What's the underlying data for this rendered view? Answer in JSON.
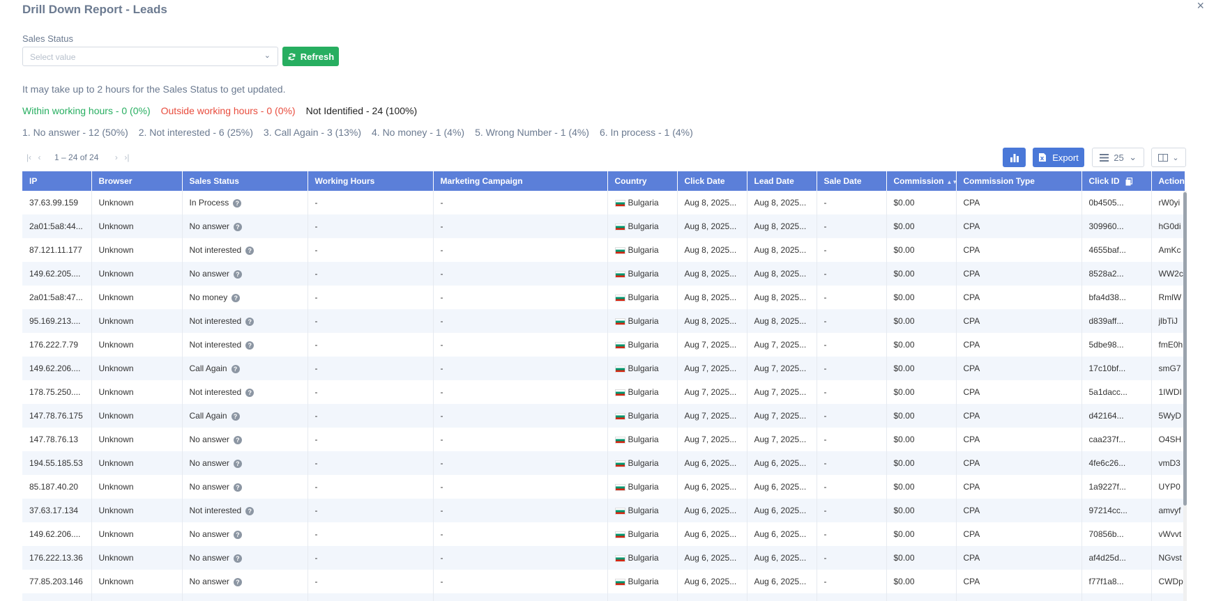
{
  "header": {
    "title": "Drill Down Report - Leads",
    "close_glyph": "×"
  },
  "filter": {
    "label": "Sales Status",
    "placeholder": "Select value",
    "refresh_label": "Refresh"
  },
  "note": "It may take up to 2 hours for the Sales Status to get updated.",
  "hours_summary": {
    "within": "Within working hours - 0 (0%)",
    "outside": "Outside working hours - 0 (0%)",
    "not_identified": "Not Identified - 24 (100%)"
  },
  "reasons": [
    "1. No answer - 12 (50%)",
    "2. Not interested - 6 (25%)",
    "3. Call Again - 3 (13%)",
    "4. No money - 1 (4%)",
    "5. Wrong Number - 1 (4%)",
    "6. In process - 1 (4%)"
  ],
  "pager": {
    "range": "1 – 24 of 24"
  },
  "toolbar": {
    "export_label": "Export",
    "page_size": "25"
  },
  "colors": {
    "header_bg": "#5b7fd9",
    "button_blue": "#4a78d8",
    "refresh_green": "#27ae60",
    "within_green": "#27ae60",
    "outside_red": "#e84c3d"
  },
  "table": {
    "headers": [
      "IP",
      "Browser",
      "Sales Status",
      "Working Hours",
      "Marketing Campaign",
      "Country",
      "Click Date",
      "Lead Date",
      "Sale Date",
      "Commission",
      "Commission Type",
      "Click ID",
      "Action I"
    ],
    "rows": [
      [
        "37.63.99.159",
        "Unknown",
        "In Process",
        "-",
        "-",
        "Bulgaria",
        "Aug 8, 2025...",
        "Aug 8, 2025...",
        "-",
        "$0.00",
        "CPA",
        "0b4505...",
        "rW0yi"
      ],
      [
        "2a01:5a8:44...",
        "Unknown",
        "No answer",
        "-",
        "-",
        "Bulgaria",
        "Aug 8, 2025...",
        "Aug 8, 2025...",
        "-",
        "$0.00",
        "CPA",
        "309960...",
        "hG0di"
      ],
      [
        "87.121.11.177",
        "Unknown",
        "Not interested",
        "-",
        "-",
        "Bulgaria",
        "Aug 8, 2025...",
        "Aug 8, 2025...",
        "-",
        "$0.00",
        "CPA",
        "4655baf...",
        "AmKc"
      ],
      [
        "149.62.205....",
        "Unknown",
        "No answer",
        "-",
        "-",
        "Bulgaria",
        "Aug 8, 2025...",
        "Aug 8, 2025...",
        "-",
        "$0.00",
        "CPA",
        "8528a2...",
        "WW2c"
      ],
      [
        "2a01:5a8:47...",
        "Unknown",
        "No money",
        "-",
        "-",
        "Bulgaria",
        "Aug 8, 2025...",
        "Aug 8, 2025...",
        "-",
        "$0.00",
        "CPA",
        "bfa4d38...",
        "RmlW"
      ],
      [
        "95.169.213....",
        "Unknown",
        "Not interested",
        "-",
        "-",
        "Bulgaria",
        "Aug 8, 2025...",
        "Aug 8, 2025...",
        "-",
        "$0.00",
        "CPA",
        "d839aff...",
        "jlbTiJ"
      ],
      [
        "176.222.7.79",
        "Unknown",
        "Not interested",
        "-",
        "-",
        "Bulgaria",
        "Aug 7, 2025...",
        "Aug 7, 2025...",
        "-",
        "$0.00",
        "CPA",
        "5dbe98...",
        "fmE0h"
      ],
      [
        "149.62.206....",
        "Unknown",
        "Call Again",
        "-",
        "-",
        "Bulgaria",
        "Aug 7, 2025...",
        "Aug 7, 2025...",
        "-",
        "$0.00",
        "CPA",
        "17c10bf...",
        "smG7"
      ],
      [
        "178.75.250....",
        "Unknown",
        "Not interested",
        "-",
        "-",
        "Bulgaria",
        "Aug 7, 2025...",
        "Aug 7, 2025...",
        "-",
        "$0.00",
        "CPA",
        "5a1dacc...",
        "1IWDI"
      ],
      [
        "147.78.76.175",
        "Unknown",
        "Call Again",
        "-",
        "-",
        "Bulgaria",
        "Aug 7, 2025...",
        "Aug 7, 2025...",
        "-",
        "$0.00",
        "CPA",
        "d42164...",
        "5WyD"
      ],
      [
        "147.78.76.13",
        "Unknown",
        "No answer",
        "-",
        "-",
        "Bulgaria",
        "Aug 7, 2025...",
        "Aug 7, 2025...",
        "-",
        "$0.00",
        "CPA",
        "caa237f...",
        "O4SH"
      ],
      [
        "194.55.185.53",
        "Unknown",
        "No answer",
        "-",
        "-",
        "Bulgaria",
        "Aug 6, 2025...",
        "Aug 6, 2025...",
        "-",
        "$0.00",
        "CPA",
        "4fe6c26...",
        "vmD3"
      ],
      [
        "85.187.40.20",
        "Unknown",
        "No answer",
        "-",
        "-",
        "Bulgaria",
        "Aug 6, 2025...",
        "Aug 6, 2025...",
        "-",
        "$0.00",
        "CPA",
        "1a9227f...",
        "UYP0"
      ],
      [
        "37.63.17.134",
        "Unknown",
        "Not interested",
        "-",
        "-",
        "Bulgaria",
        "Aug 6, 2025...",
        "Aug 6, 2025...",
        "-",
        "$0.00",
        "CPA",
        "97214cc...",
        "amvyf"
      ],
      [
        "149.62.206....",
        "Unknown",
        "No answer",
        "-",
        "-",
        "Bulgaria",
        "Aug 6, 2025...",
        "Aug 6, 2025...",
        "-",
        "$0.00",
        "CPA",
        "70856b...",
        "vWvvt"
      ],
      [
        "176.222.13.36",
        "Unknown",
        "No answer",
        "-",
        "-",
        "Bulgaria",
        "Aug 6, 2025...",
        "Aug 6, 2025...",
        "-",
        "$0.00",
        "CPA",
        "af4d25d...",
        "NGvst"
      ],
      [
        "77.85.203.146",
        "Unknown",
        "No answer",
        "-",
        "-",
        "Bulgaria",
        "Aug 6, 2025...",
        "Aug 6, 2025...",
        "-",
        "$0.00",
        "CPA",
        "f77f1a8...",
        "CWDp"
      ],
      [
        "",
        "",
        "",
        "",
        "",
        "",
        "",
        "",
        "",
        "",
        "",
        "",
        ""
      ]
    ]
  }
}
